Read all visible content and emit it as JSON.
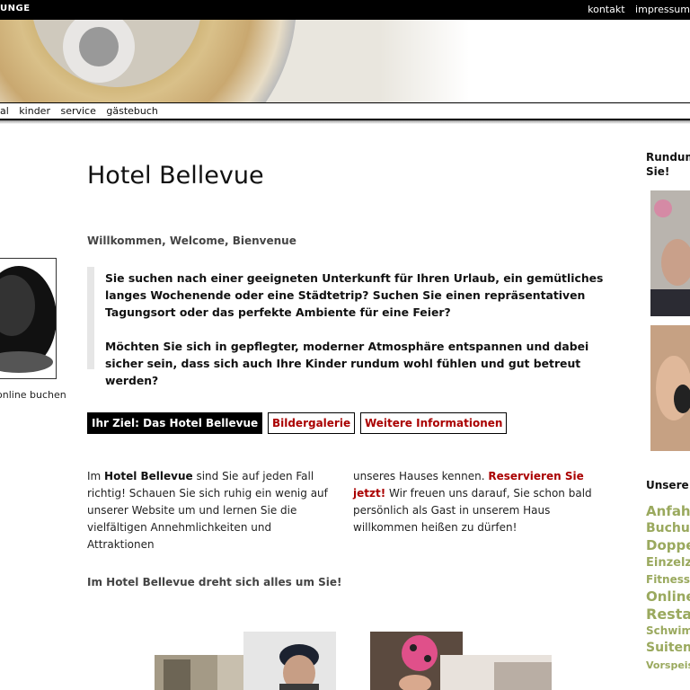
{
  "topbar": {
    "brand": "UNGE",
    "links": [
      "kontakt",
      "impressum"
    ]
  },
  "nav": {
    "items": [
      "al",
      "kinder",
      "service",
      "gästebuch"
    ]
  },
  "sidebar_left": {
    "online_link": "online buchen"
  },
  "main": {
    "title": "Hotel Bellevue",
    "welcome": "Willkommen, Welcome, Bienvenue",
    "intro_p1": "Sie suchen nach einer geeigneten Unterkunft für Ihren Urlaub, ein gemütliches langes Wochenende oder eine Städtetrip? Suchen Sie einen repräsentativen Tagungsort oder das perfekte Ambiente für eine Feier?",
    "intro_p2": "Möchten Sie sich in gepflegter, moderner Atmosphäre entspannen und dabei sicher sein, dass sich auch Ihre Kinder rundum wohl fühlen und gut betreut werden?",
    "tabs": [
      "Ihr Ziel: Das Hotel Bellevue",
      "Bildergalerie",
      "Weitere Informationen"
    ],
    "col1": {
      "prefix": "Im ",
      "bold": "Hotel Bellevue",
      "rest": " sind Sie auf jeden Fall richtig! Schauen Sie sich ruhig ein wenig auf unserer Website um und lernen Sie die vielfältigen Annehmlichkeiten und Attraktionen"
    },
    "col2": {
      "prefix": "unseres Hauses kennen. ",
      "link": "Reservieren Sie jetzt!",
      "rest": " Wir freuen uns darauf, Sie schon bald persönlich als Gast in unserem Haus willkommen heißen zu dürfen!"
    },
    "tagline": "Im Hotel Bellevue dreht sich alles um Sie!"
  },
  "sidebar_right": {
    "heading_line1": "Rundum",
    "heading_line2": "Sie!",
    "unsere": "Unsere",
    "tags": [
      {
        "text": "Anfahrt",
        "size": 15
      },
      {
        "text": "Buchun",
        "size": 14
      },
      {
        "text": "Doppel",
        "size": 15
      },
      {
        "text": "Einzelz",
        "size": 13
      },
      {
        "text": "Fitness",
        "size": 12
      },
      {
        "text": "Online",
        "size": 15
      },
      {
        "text": "Restau",
        "size": 16
      },
      {
        "text": "Schwim",
        "size": 12
      },
      {
        "text": "Suiten",
        "size": 14
      },
      {
        "text": "Vorspeis",
        "size": 11
      }
    ]
  },
  "colors": {
    "accent_red": "#aa0000",
    "tag_green": "#9aa95e",
    "black": "#000000"
  }
}
